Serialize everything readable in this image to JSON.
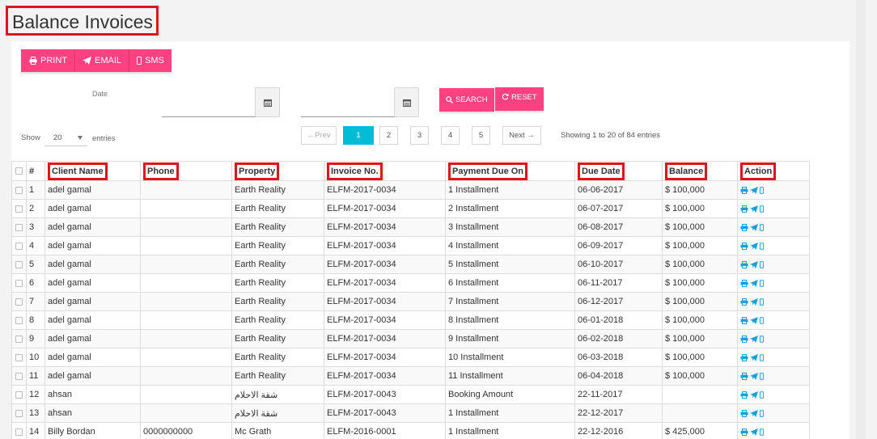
{
  "page": {
    "title": "Balance Invoices"
  },
  "toolbar": {
    "print_label": "PRINT",
    "email_label": "EMAIL",
    "sms_label": "SMS"
  },
  "filters": {
    "date_label": "Date",
    "from_value": "",
    "to_value": "",
    "search_label": "SEARCH",
    "reset_label": "RESET"
  },
  "length": {
    "show_label": "Show",
    "value": "20",
    "entries_label": "entries"
  },
  "pagination": {
    "prev_label": "←Prev",
    "pages": [
      "1",
      "2",
      "3",
      "4",
      "5"
    ],
    "active_page": "1",
    "next_label": "Next →",
    "info": "Showing 1 to 20 of 84 entries"
  },
  "table": {
    "headers": [
      "#",
      "Client Name",
      "Phone",
      "Property",
      "Invoice No.",
      "Payment Due On",
      "Due Date",
      "Balance",
      "Action"
    ],
    "rows": [
      [
        "1",
        "adel gamal",
        "",
        "Earth Reality",
        "ELFM-2017-0034",
        "1 Installment",
        "06-06-2017",
        "$ 100,000"
      ],
      [
        "2",
        "adel gamal",
        "",
        "Earth Reality",
        "ELFM-2017-0034",
        "2 Installment",
        "06-07-2017",
        "$ 100,000"
      ],
      [
        "3",
        "adel gamal",
        "",
        "Earth Reality",
        "ELFM-2017-0034",
        "3 Installment",
        "06-08-2017",
        "$ 100,000"
      ],
      [
        "4",
        "adel gamal",
        "",
        "Earth Reality",
        "ELFM-2017-0034",
        "4 Installment",
        "06-09-2017",
        "$ 100,000"
      ],
      [
        "5",
        "adel gamal",
        "",
        "Earth Reality",
        "ELFM-2017-0034",
        "5 Installment",
        "06-10-2017",
        "$ 100,000"
      ],
      [
        "6",
        "adel gamal",
        "",
        "Earth Reality",
        "ELFM-2017-0034",
        "6 Installment",
        "06-11-2017",
        "$ 100,000"
      ],
      [
        "7",
        "adel gamal",
        "",
        "Earth Reality",
        "ELFM-2017-0034",
        "7 Installment",
        "06-12-2017",
        "$ 100,000"
      ],
      [
        "8",
        "adel gamal",
        "",
        "Earth Reality",
        "ELFM-2017-0034",
        "8 Installment",
        "06-01-2018",
        "$ 100,000"
      ],
      [
        "9",
        "adel gamal",
        "",
        "Earth Reality",
        "ELFM-2017-0034",
        "9 Installment",
        "06-02-2018",
        "$ 100,000"
      ],
      [
        "10",
        "adel gamal",
        "",
        "Earth Reality",
        "ELFM-2017-0034",
        "10 Installment",
        "06-03-2018",
        "$ 100,000"
      ],
      [
        "11",
        "adel gamal",
        "",
        "Earth Reality",
        "ELFM-2017-0034",
        "11 Installment",
        "06-04-2018",
        "$ 100,000"
      ],
      [
        "12",
        "ahsan",
        "",
        "شقة الاحلام",
        "ELFM-2017-0043",
        "Booking Amount",
        "22-11-2017",
        ""
      ],
      [
        "13",
        "ahsan",
        "",
        "شقة الاحلام",
        "ELFM-2017-0043",
        "1 Installment",
        "22-12-2017",
        ""
      ],
      [
        "14",
        "Billy Bordan",
        "0000000000",
        "Mc Grath",
        "ELFM-2016-0001",
        "1 Installment",
        "22-12-2016",
        "$ 425,000"
      ]
    ]
  },
  "colors": {
    "accent": "#ff4081",
    "active_page": "#00bcd4",
    "action_icon": "#1a9fd9",
    "highlight_border": "#e0141b"
  }
}
